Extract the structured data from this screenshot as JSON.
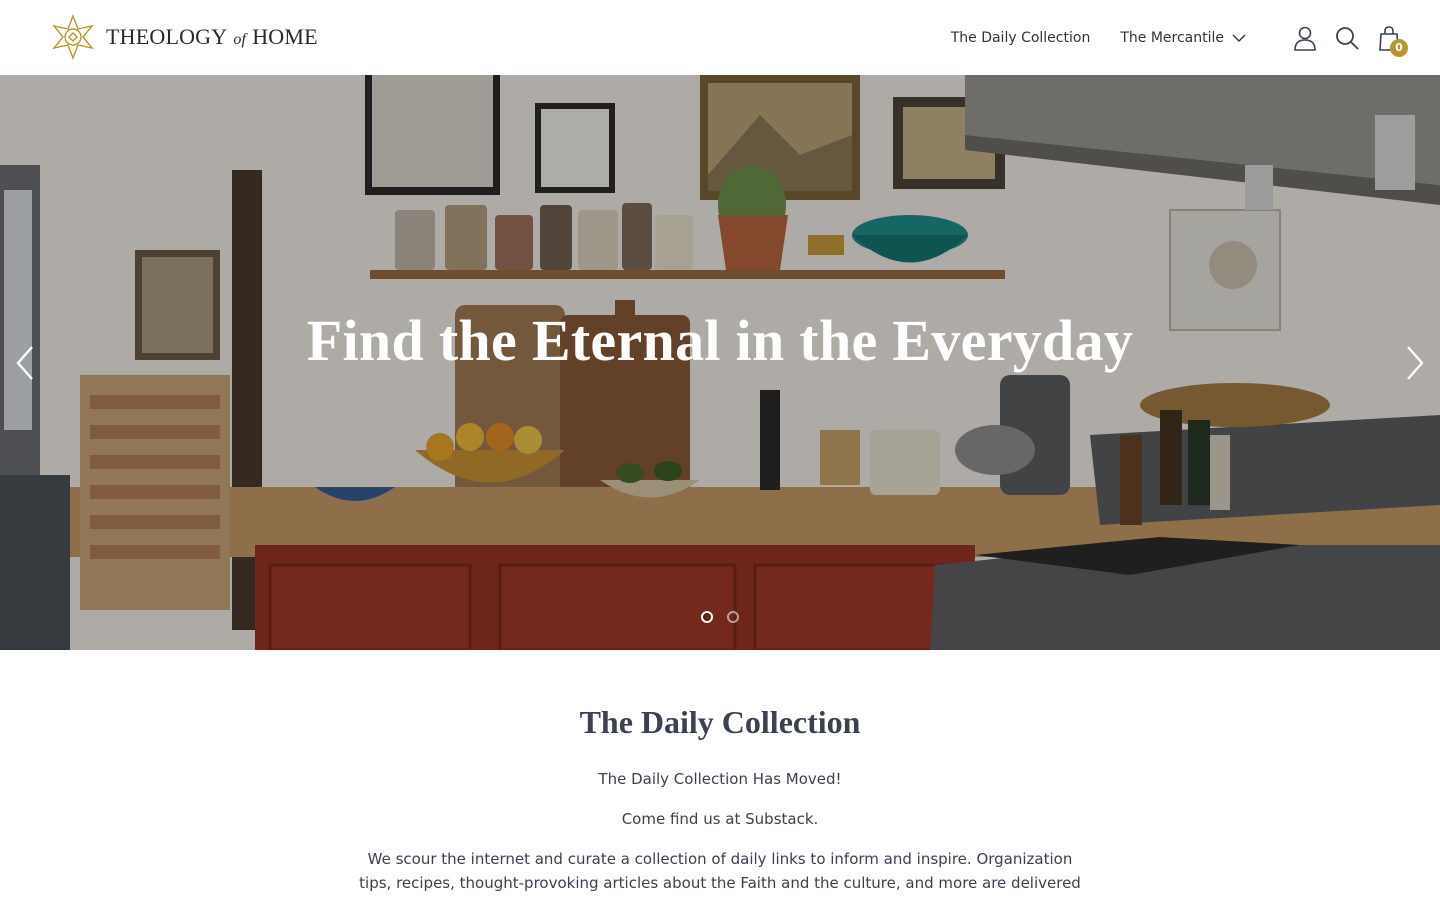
{
  "header": {
    "logo_text_main": "THEOLOGY",
    "logo_text_of": "of",
    "logo_text_end": "HOME",
    "nav": {
      "daily_collection": "The Daily Collection",
      "mercantile": "The Mercantile"
    },
    "cart_count": "0",
    "icons": [
      "account-icon",
      "search-icon",
      "cart-icon",
      "chevron-down-icon"
    ],
    "accent_color": "#b8962e"
  },
  "hero": {
    "title": "Find the Eternal in the Everyday",
    "slides_total": 2,
    "active_slide": 1,
    "icons": [
      "chevron-left-icon",
      "chevron-right-icon"
    ]
  },
  "content": {
    "title": "The Daily Collection",
    "line1": "The Daily Collection Has Moved!",
    "line2": "Come find us at Substack.",
    "line3": "We scour the internet and curate a collection of daily links to inform and inspire. Organization tips, recipes, thought-provoking articles about the Faith and the culture, and more are delivered in one easy email to your inbox daily."
  }
}
